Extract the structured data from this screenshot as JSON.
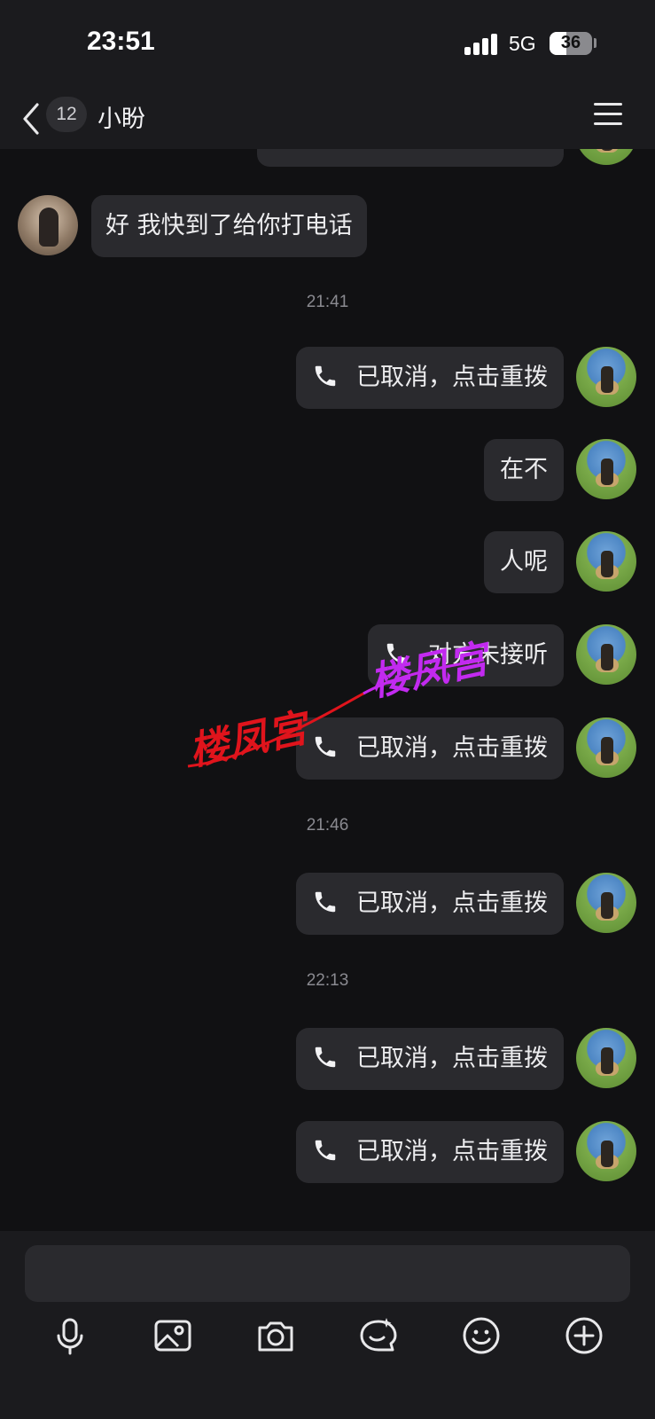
{
  "status": {
    "time": "23:51",
    "network": "5G",
    "battery": "36"
  },
  "header": {
    "unread_count": "12",
    "contact_name": "小盼"
  },
  "messages": {
    "her_msg": "好 我快到了给你打电话",
    "time_1": "21:41",
    "call_1": "已取消，点击重拨",
    "msg_zaibu": "在不",
    "msg_renne": "人呢",
    "call_missed": "对方未接听",
    "call_2": "已取消，点击重拨",
    "time_2": "21:46",
    "call_3": "已取消，点击重拨",
    "time_3": "22:13",
    "call_4": "已取消，点击重拨",
    "call_5": "已取消，点击重拨"
  },
  "watermark": {
    "left_text": "楼凤宫",
    "right_text": "楼凤宫"
  },
  "composer": {
    "placeholder": ""
  },
  "colors": {
    "bg": "#111113",
    "bar": "#1b1b1e",
    "bubble": "#2a2a2e",
    "watermark_red": "#e0141c",
    "watermark_purple": "#c22af0"
  },
  "icons": [
    "back-arrow-icon",
    "menu-icon",
    "phone-icon",
    "microphone-icon",
    "image-icon",
    "camera-icon",
    "sticker-icon",
    "emoji-icon",
    "plus-icon"
  ]
}
